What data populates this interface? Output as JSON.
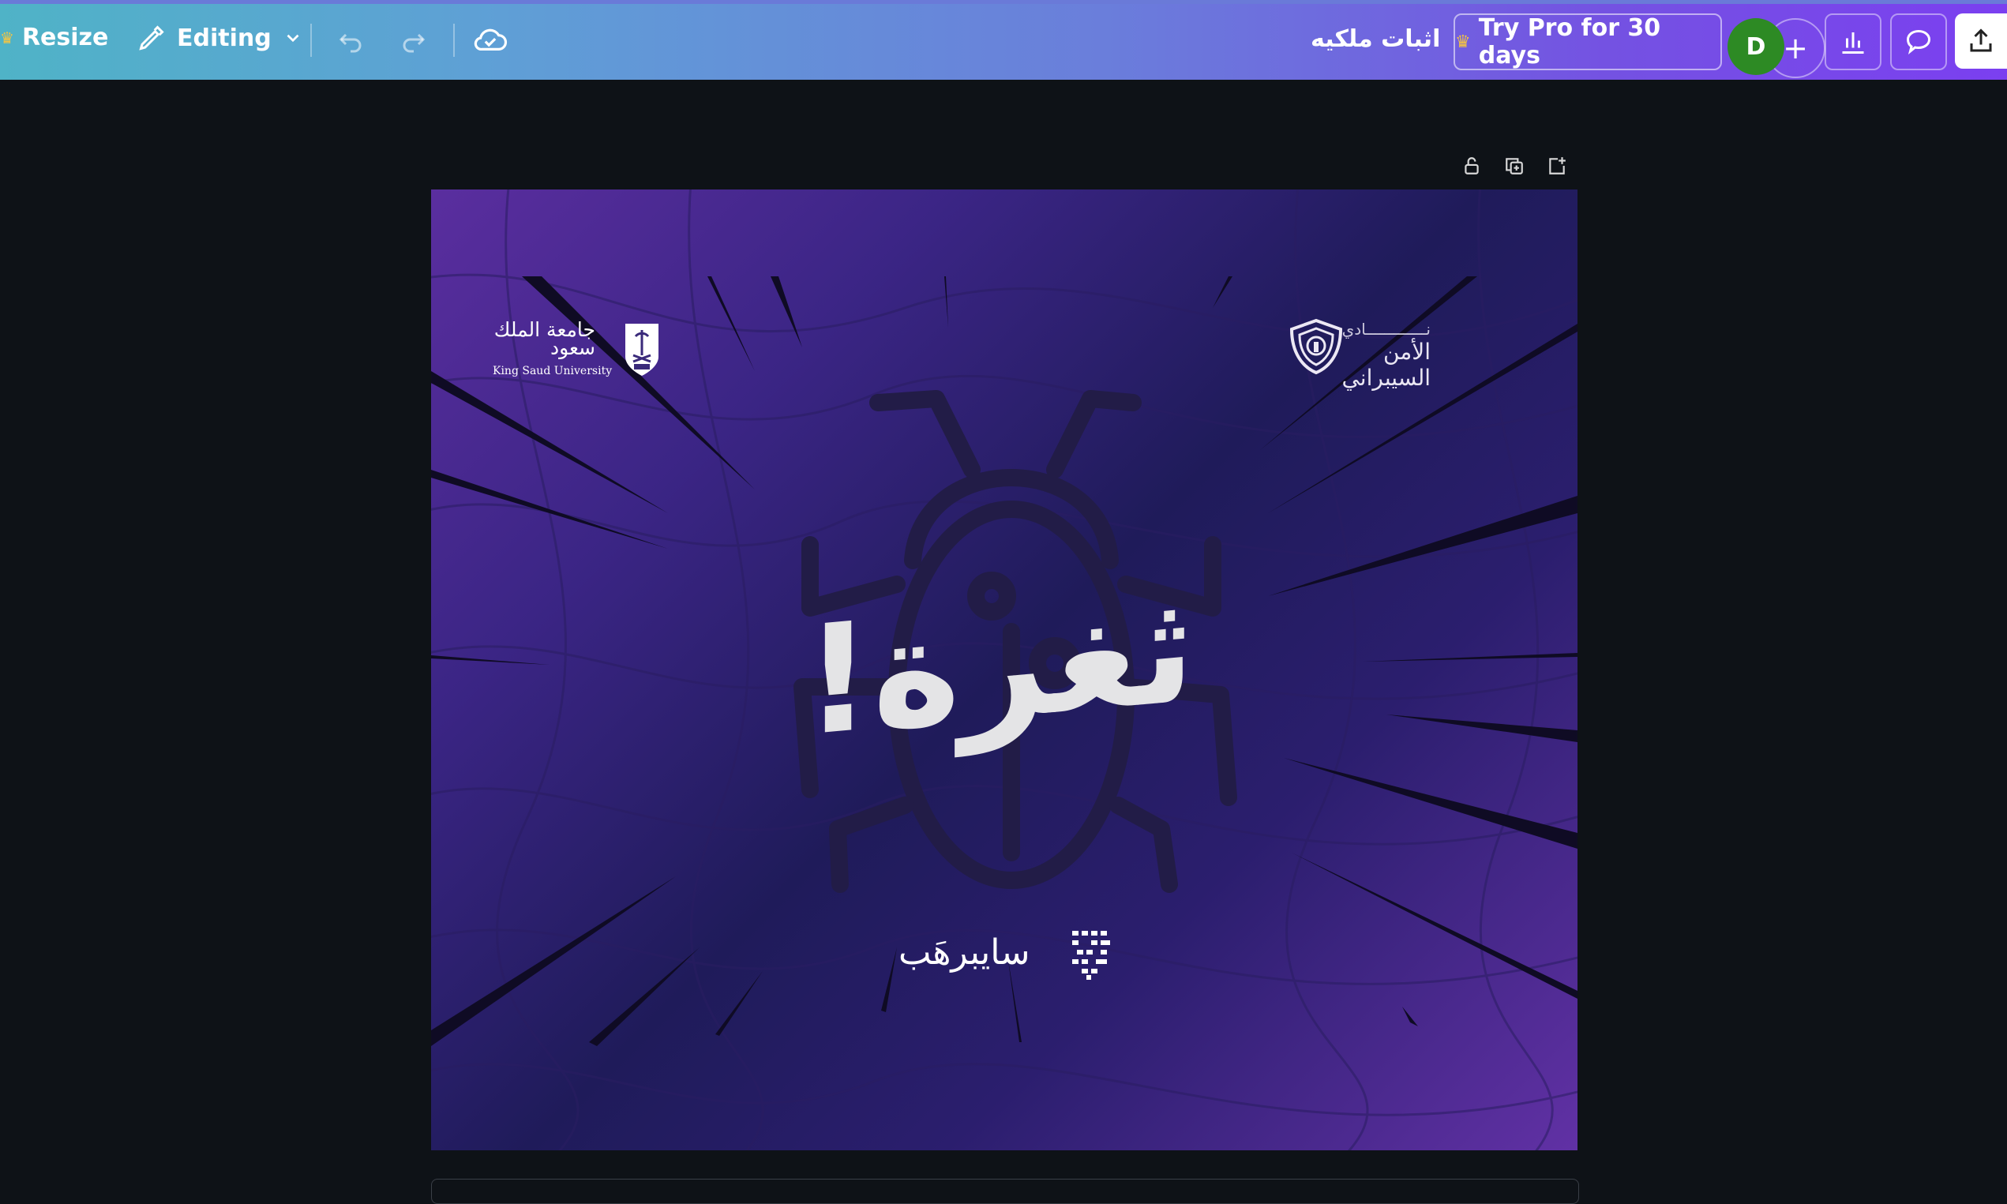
{
  "toolbar": {
    "resize_label": "Resize",
    "editing_label": "Editing",
    "doc_title": "اثبات ملكيه",
    "try_pro_label": "Try Pro for 30 days",
    "avatar_initial": "D",
    "add_label": "+",
    "colors": {
      "start": "#4fb3c7",
      "end": "#7b3ff0"
    }
  },
  "page_tools": {
    "icons": [
      "lock-icon",
      "duplicate-page-icon",
      "add-page-icon"
    ]
  },
  "design": {
    "ksu_logo": {
      "arabic_name": "جامعة الملك سعود",
      "english_name": "King Saud University"
    },
    "club_logo": {
      "line1": "نـــــــــــــادي",
      "line2": "الأمن السيبراني"
    },
    "headline": "ثغرة!",
    "brand": "سايبرهَب",
    "colors": {
      "bg_purple": "#5a2e9f",
      "bg_navy": "#1f1b5a",
      "bug": "#241f45",
      "headline": "#e4e4e6"
    }
  }
}
